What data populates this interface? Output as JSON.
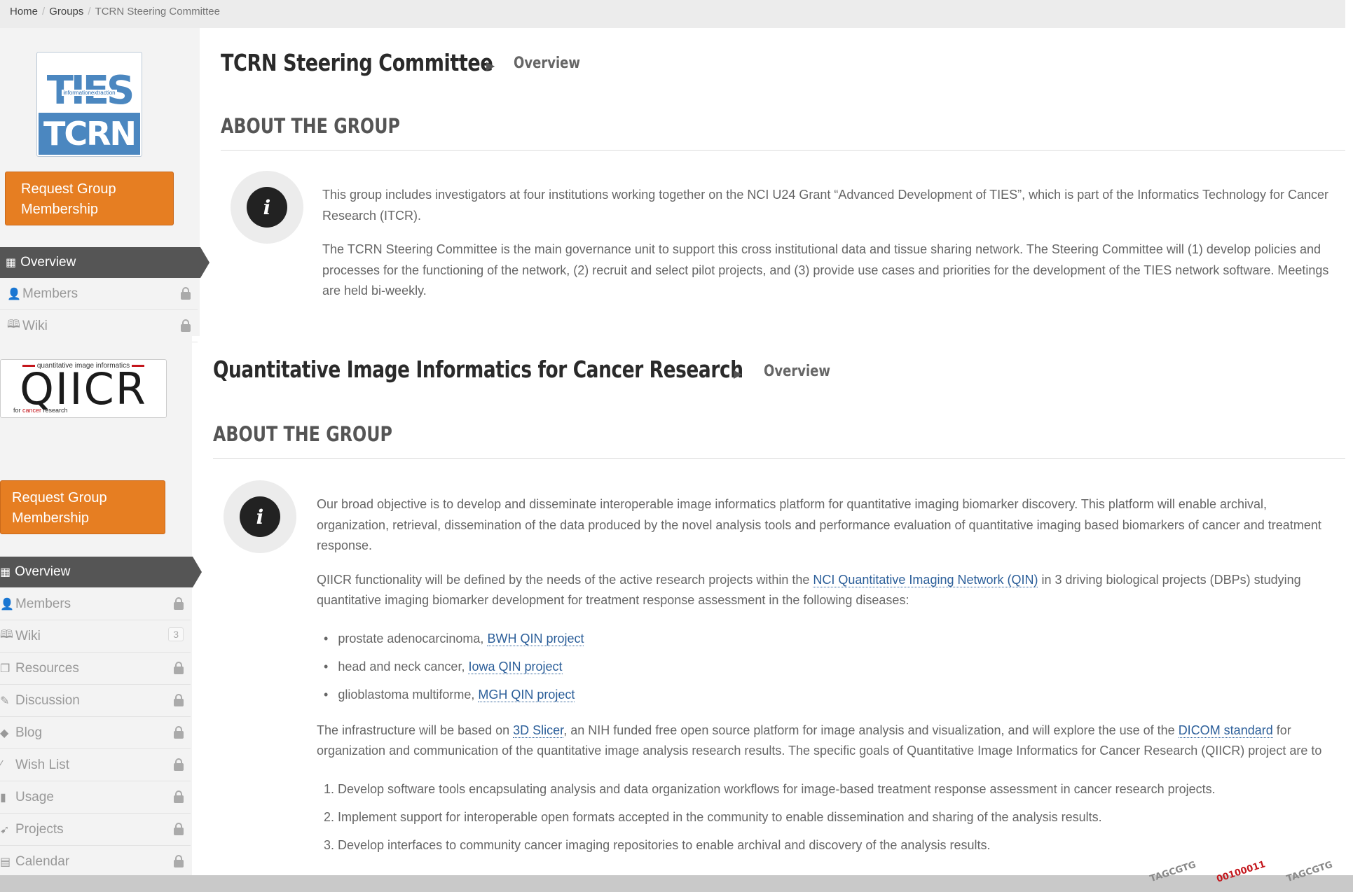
{
  "breadcrumb": {
    "home": "Home",
    "groups": "Groups",
    "current": "TCRN Steering Committee"
  },
  "section1": {
    "logo": {
      "ties": "TIES",
      "subtitle": "informationextraction",
      "tcrn": "TCRN"
    },
    "request_button": "Request Group Membership",
    "nav": {
      "overview": "Overview",
      "members": "Members",
      "wiki": "Wiki"
    },
    "title": "TCRN Steering Committee",
    "crumb_sub": "Overview",
    "about_heading": "ABOUT THE GROUP",
    "para1": "This group includes investigators at four institutions working together on the NCI U24 Grant “Advanced Development of TIES”, which is part of the Informatics Technology for Cancer Research (ITCR).",
    "para2": "The TCRN Steering Committee is the main governance unit to support this cross institutional data and tissue sharing network. The Steering Committee will (1) develop policies and processes for the functioning of the network, (2) recruit and select pilot projects, and (3) provide use cases and priorities for the development of the TIES network software. Meetings are held bi-weekly."
  },
  "section2": {
    "logo": {
      "tagline": "quantitative image informatics",
      "word": "QIICR",
      "sub_prefix": "for ",
      "sub_highlight": "cancer",
      "sub_suffix": " research"
    },
    "request_button": "Request Group Membership",
    "nav": {
      "overview": "Overview",
      "members": "Members",
      "wiki": "Wiki",
      "wiki_count": "3",
      "resources": "Resources",
      "discussion": "Discussion",
      "blog": "Blog",
      "wish_list": "Wish List",
      "usage": "Usage",
      "projects": "Projects",
      "calendar": "Calendar"
    },
    "title": "Quantitative Image Informatics for Cancer Research",
    "crumb_sub": "Overview",
    "about_heading": "ABOUT THE GROUP",
    "para1": "Our broad objective is to develop and disseminate interoperable image informatics platform for quantitative imaging biomarker discovery. This platform will enable archival, organization, retrieval, dissemination of the data produced by the novel analysis tools and performance evaluation of quantitative imaging based biomarkers of cancer and treatment response.",
    "para2_pre": "QIICR functionality will be defined by the needs of the active research projects within the ",
    "para2_link": "NCI Quantitative Imaging Network (QIN)",
    "para2_post": " in 3 driving biological projects (DBPs) studying quantitative imaging biomarker development for treatment response assessment in the following diseases:",
    "diseases": [
      {
        "text": "prostate adenocarcinoma, ",
        "link": "BWH QIN project"
      },
      {
        "text": "head and neck cancer, ",
        "link": "Iowa QIN project"
      },
      {
        "text": "glioblastoma multiforme, ",
        "link": "MGH QIN project"
      }
    ],
    "para3_a": "The infrastructure will be based on ",
    "para3_link1": "3D Slicer",
    "para3_b": ", an NIH funded free open source platform for image analysis and visualization, and will explore the use of the ",
    "para3_link2": "DICOM standard",
    "para3_c": " for organization and communication of the quantitative image analysis research results. The specific goals of Quantitative Image Informatics for Cancer Research (QIICR) project are to",
    "goals": [
      "1.  Develop software tools encapsulating analysis and data organization workflows for image-based treatment response assessment in cancer research projects.",
      "2.  Implement support for interoperable open formats accepted in the community to enable dissemination and sharing of the analysis results.",
      "3.  Develop interfaces to community cancer imaging repositories to enable archival and discovery of the analysis results."
    ]
  },
  "footer_fragments": [
    "TAGCGTG",
    "00100011",
    "TAGCGTG"
  ]
}
